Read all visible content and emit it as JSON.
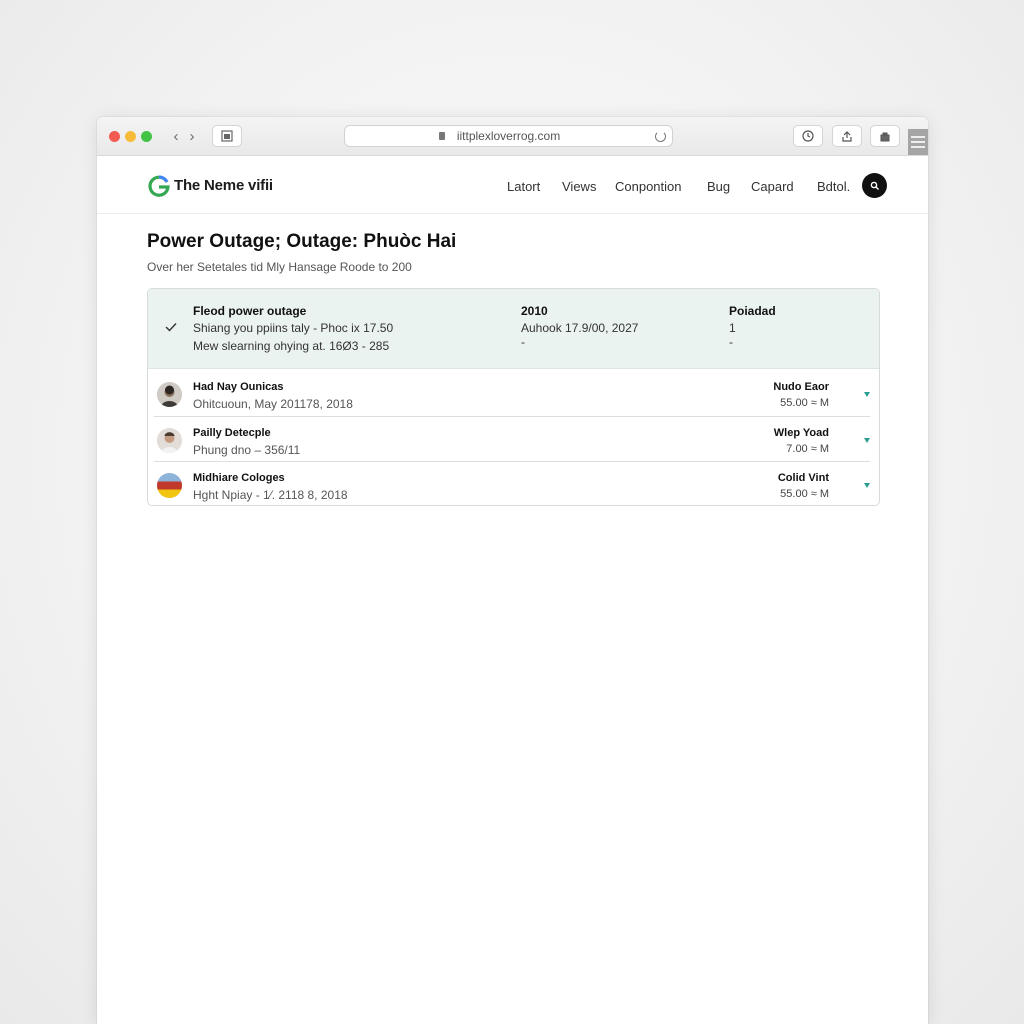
{
  "browser": {
    "url": "iittplexloverrog.com",
    "accent_colors": {
      "close": "#f25b52",
      "minimize": "#f7bb3a",
      "maximize": "#43c346"
    }
  },
  "site": {
    "brand": "The Neme vifii",
    "nav": [
      "Latort",
      "Views",
      "Conpontion",
      "Bug",
      "Capard",
      "Bdtol."
    ]
  },
  "page": {
    "title": "Power Outage; Outage: Phuòc Hai",
    "subtitle": "Over her Setetales tid Mly Hansage Roode to 200"
  },
  "card": {
    "header": {
      "col1_title": "Fleod power outage",
      "col1_line1": "Shiang you ppiins taly - Phoc ix 17.50",
      "col1_line2": "Mew slearning ohying at. 16Ø3 - 285",
      "col2_title": "2010",
      "col2_line1": "Auhook 17.9/00, 2027",
      "col2_line2": "-",
      "col3_title": "Poiadad",
      "col3_line1": "1",
      "col3_line2": "-"
    },
    "rows": [
      {
        "name": "Had Nay Ounicas",
        "meta": "Ohitcuoun, May 201178, 2018",
        "right_title": "Nudo Eaor",
        "right_value": "55.00 ≈ M"
      },
      {
        "name": "Pailly Detecple",
        "meta": "Phung dno – 356/11",
        "right_title": "Wlep Yoad",
        "right_value": "7.00 ≈ M"
      },
      {
        "name": "Midhiare Cologes",
        "meta": "Hght Npiay - 1⁄. 2118 8, 2018",
        "right_title": "Colid Vint",
        "right_value": "55.00 ≈ M"
      }
    ]
  },
  "colors": {
    "card_header_bg": "#ebf3f1",
    "chevron_teal": "#2a9d8f"
  }
}
